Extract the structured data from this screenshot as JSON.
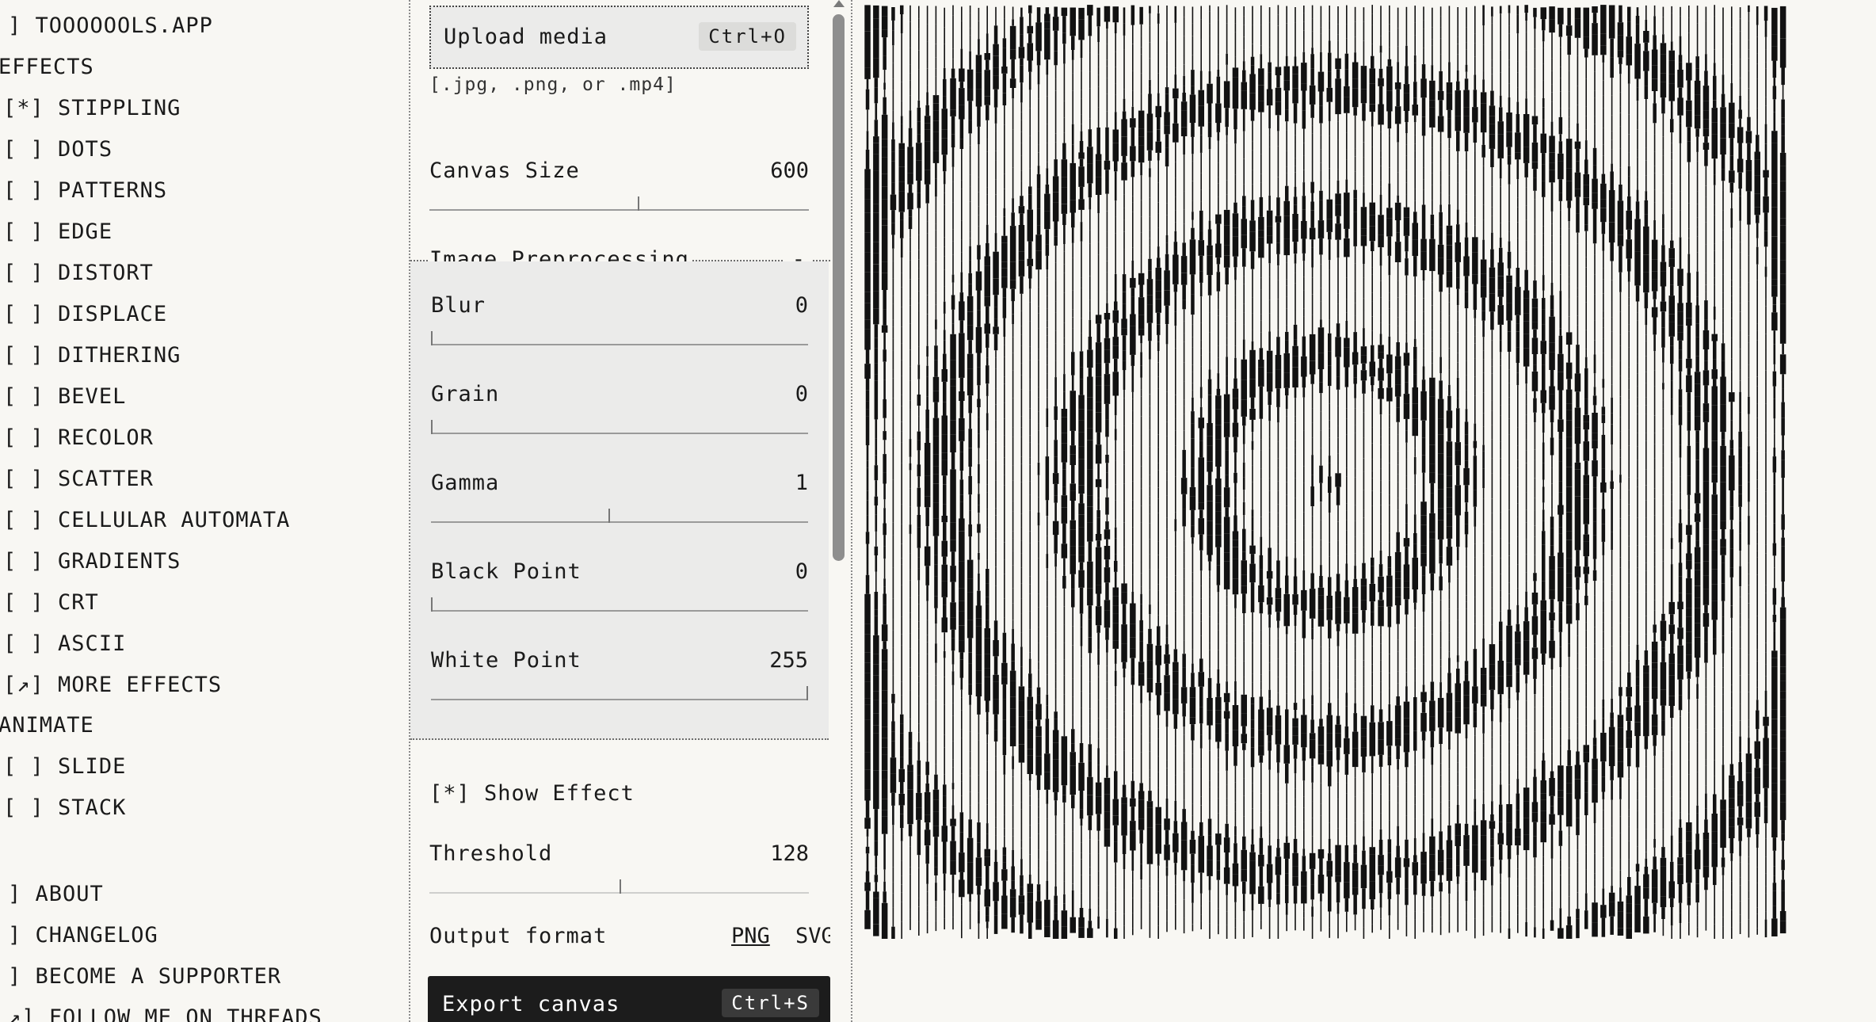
{
  "nav": {
    "app_title": "] TOOOOOOLS.APP",
    "effects_header": "EFFECTS",
    "effects": [
      {
        "box": "[*]",
        "label": "STIPPLING"
      },
      {
        "box": "[ ]",
        "label": "DOTS"
      },
      {
        "box": "[ ]",
        "label": "PATTERNS"
      },
      {
        "box": "[ ]",
        "label": "EDGE"
      },
      {
        "box": "[ ]",
        "label": "DISTORT"
      },
      {
        "box": "[ ]",
        "label": "DISPLACE"
      },
      {
        "box": "[ ]",
        "label": "DITHERING"
      },
      {
        "box": "[ ]",
        "label": "BEVEL"
      },
      {
        "box": "[ ]",
        "label": "RECOLOR"
      },
      {
        "box": "[ ]",
        "label": "SCATTER"
      },
      {
        "box": "[ ]",
        "label": "CELLULAR AUTOMATA"
      },
      {
        "box": "[ ]",
        "label": "GRADIENTS"
      },
      {
        "box": "[ ]",
        "label": "CRT"
      },
      {
        "box": "[ ]",
        "label": "ASCII"
      },
      {
        "box": "[↗]",
        "label": "MORE EFFECTS"
      }
    ],
    "animate_header": "ANIMATE",
    "animate": [
      {
        "box": "[ ]",
        "label": "SLIDE"
      },
      {
        "box": "[ ]",
        "label": "STACK"
      }
    ],
    "footer": [
      {
        "label": "] ABOUT"
      },
      {
        "label": "] CHANGELOG"
      },
      {
        "label": "] BECOME A SUPPORTER"
      },
      {
        "label": "↗] FOLLOW ME ON THREADS"
      }
    ]
  },
  "panel": {
    "upload": {
      "label": "Upload media",
      "shortcut": "Ctrl+O"
    },
    "upload_hint": "[.jpg, .png, or .mp4]",
    "canvas_size": {
      "label": "Canvas Size",
      "value": "600",
      "fraction": 0.55
    },
    "preprocessing": {
      "title": "Image Preprocessing",
      "collapse_label": "-",
      "sliders": [
        {
          "label": "Blur",
          "value": "0",
          "fraction": 0.0
        },
        {
          "label": "Grain",
          "value": "0",
          "fraction": 0.0
        },
        {
          "label": "Gamma",
          "value": "1",
          "fraction": 0.47
        },
        {
          "label": "Black Point",
          "value": "0",
          "fraction": 0.0
        },
        {
          "label": "White Point",
          "value": "255",
          "fraction": 1.0
        }
      ]
    },
    "show_effect": {
      "box": "[*]",
      "label": "Show Effect"
    },
    "threshold": {
      "label": "Threshold",
      "value": "128",
      "fraction": 0.5
    },
    "output": {
      "label": "Output format",
      "png": "PNG",
      "svg": "SVG"
    },
    "export": {
      "label": "Export canvas",
      "shortcut": "Ctrl+S"
    }
  },
  "colors": {
    "background": "#f8f7f3",
    "ink": "#1a1a1a",
    "panel_shade": "#ebebea",
    "button_dark": "#1c1c1c"
  }
}
